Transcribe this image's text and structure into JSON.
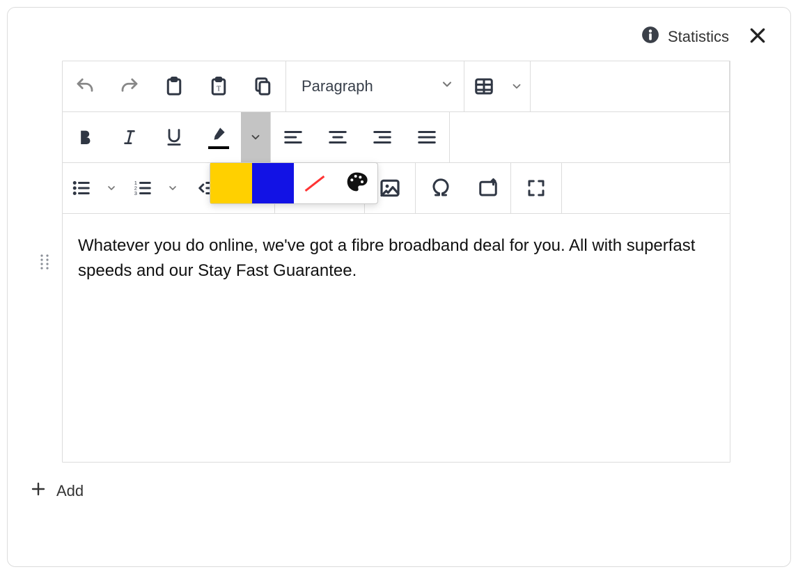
{
  "topbar": {
    "statistics_label": "Statistics"
  },
  "toolbar": {
    "format_select": "Paragraph",
    "highlight_swatch_colors": {
      "yellow": "#ffd000",
      "blue": "#1212e5"
    }
  },
  "content": {
    "text": "Whatever you do online, we've got a fibre broadband deal for you. All with superfast speeds and our Stay Fast Guarantee."
  },
  "footer": {
    "add_label": "Add"
  }
}
